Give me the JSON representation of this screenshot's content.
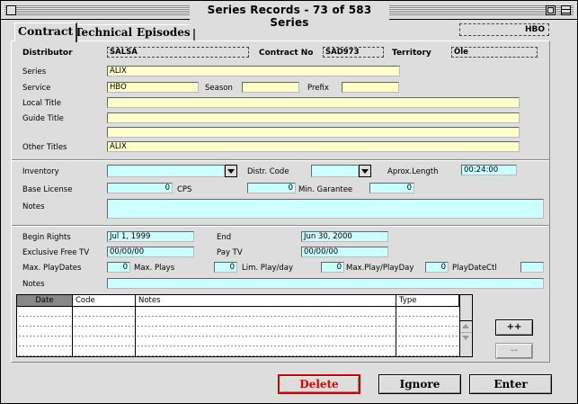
{
  "window": {
    "title": "Series Records - 73 of 583 Series"
  },
  "tabs": [
    {
      "label": "Contract",
      "active": true
    },
    {
      "label": "Technical",
      "active": false
    },
    {
      "label": "Episodes",
      "active": false
    }
  ],
  "header_badge": "HBO",
  "contract": {
    "distributor_label": "Distributor",
    "distributor_value": "SALSA",
    "contract_no_label": "Contract No",
    "contract_no_value": "SAD973",
    "territory_label": "Territory",
    "territory_value": "Ole",
    "series_label": "Series",
    "series_value": "ALIX",
    "service_label": "Service",
    "service_value": "HBO",
    "season_label": "Season",
    "season_value": "",
    "prefix_label": "Prefix",
    "prefix_value": "",
    "local_title_label": "Local Title",
    "local_title_value": "",
    "guide_title_label": "Guide Title",
    "guide_title_value": "",
    "guide_title_value2": "",
    "other_titles_label": "Other Titles",
    "other_titles_value": "ALIX"
  },
  "inventory": {
    "inventory_label": "Inventory",
    "inventory_value": "",
    "distr_code_label": "Distr. Code",
    "distr_code_value": "",
    "aprox_length_label": "Aprox.Length",
    "aprox_length_value": "00:24:00",
    "base_license_label": "Base License",
    "base_license_value": "0",
    "cps_label": "CPS",
    "cps_value": "0",
    "min_garantee_label": "Min. Garantee",
    "min_garantee_value": "0",
    "notes_label": "Notes",
    "notes_value": ""
  },
  "rights": {
    "begin_rights_label": "Begin Rights",
    "begin_rights_value": "Jul 1, 1999",
    "end_label": "End",
    "end_value": "Jun 30, 2000",
    "exclusive_free_tv_label": "Exclusive Free TV",
    "exclusive_free_tv_value": "00/00/00",
    "pay_tv_label": "Pay TV",
    "pay_tv_value": "00/00/00",
    "max_play_dates_label": "Max. PlayDates",
    "max_play_dates_value": "0",
    "max_plays_label": "Max. Plays",
    "max_plays_value": "0",
    "lim_play_day_label": "Lim. Play/day",
    "lim_play_day_value": "0",
    "max_play_playday_label": "Max.Play/PlayDay",
    "max_play_playday_value": "0",
    "play_date_ctl_label": "PlayDateCtl",
    "play_date_ctl_value": "",
    "notes_label": "Notes",
    "notes_value": ""
  },
  "table": {
    "columns": [
      "Date",
      "Code",
      "Notes",
      "Type"
    ]
  },
  "side_buttons": {
    "add": "++",
    "remove": "--"
  },
  "buttons": {
    "delete": "Delete",
    "ignore": "Ignore",
    "enter": "Enter"
  }
}
